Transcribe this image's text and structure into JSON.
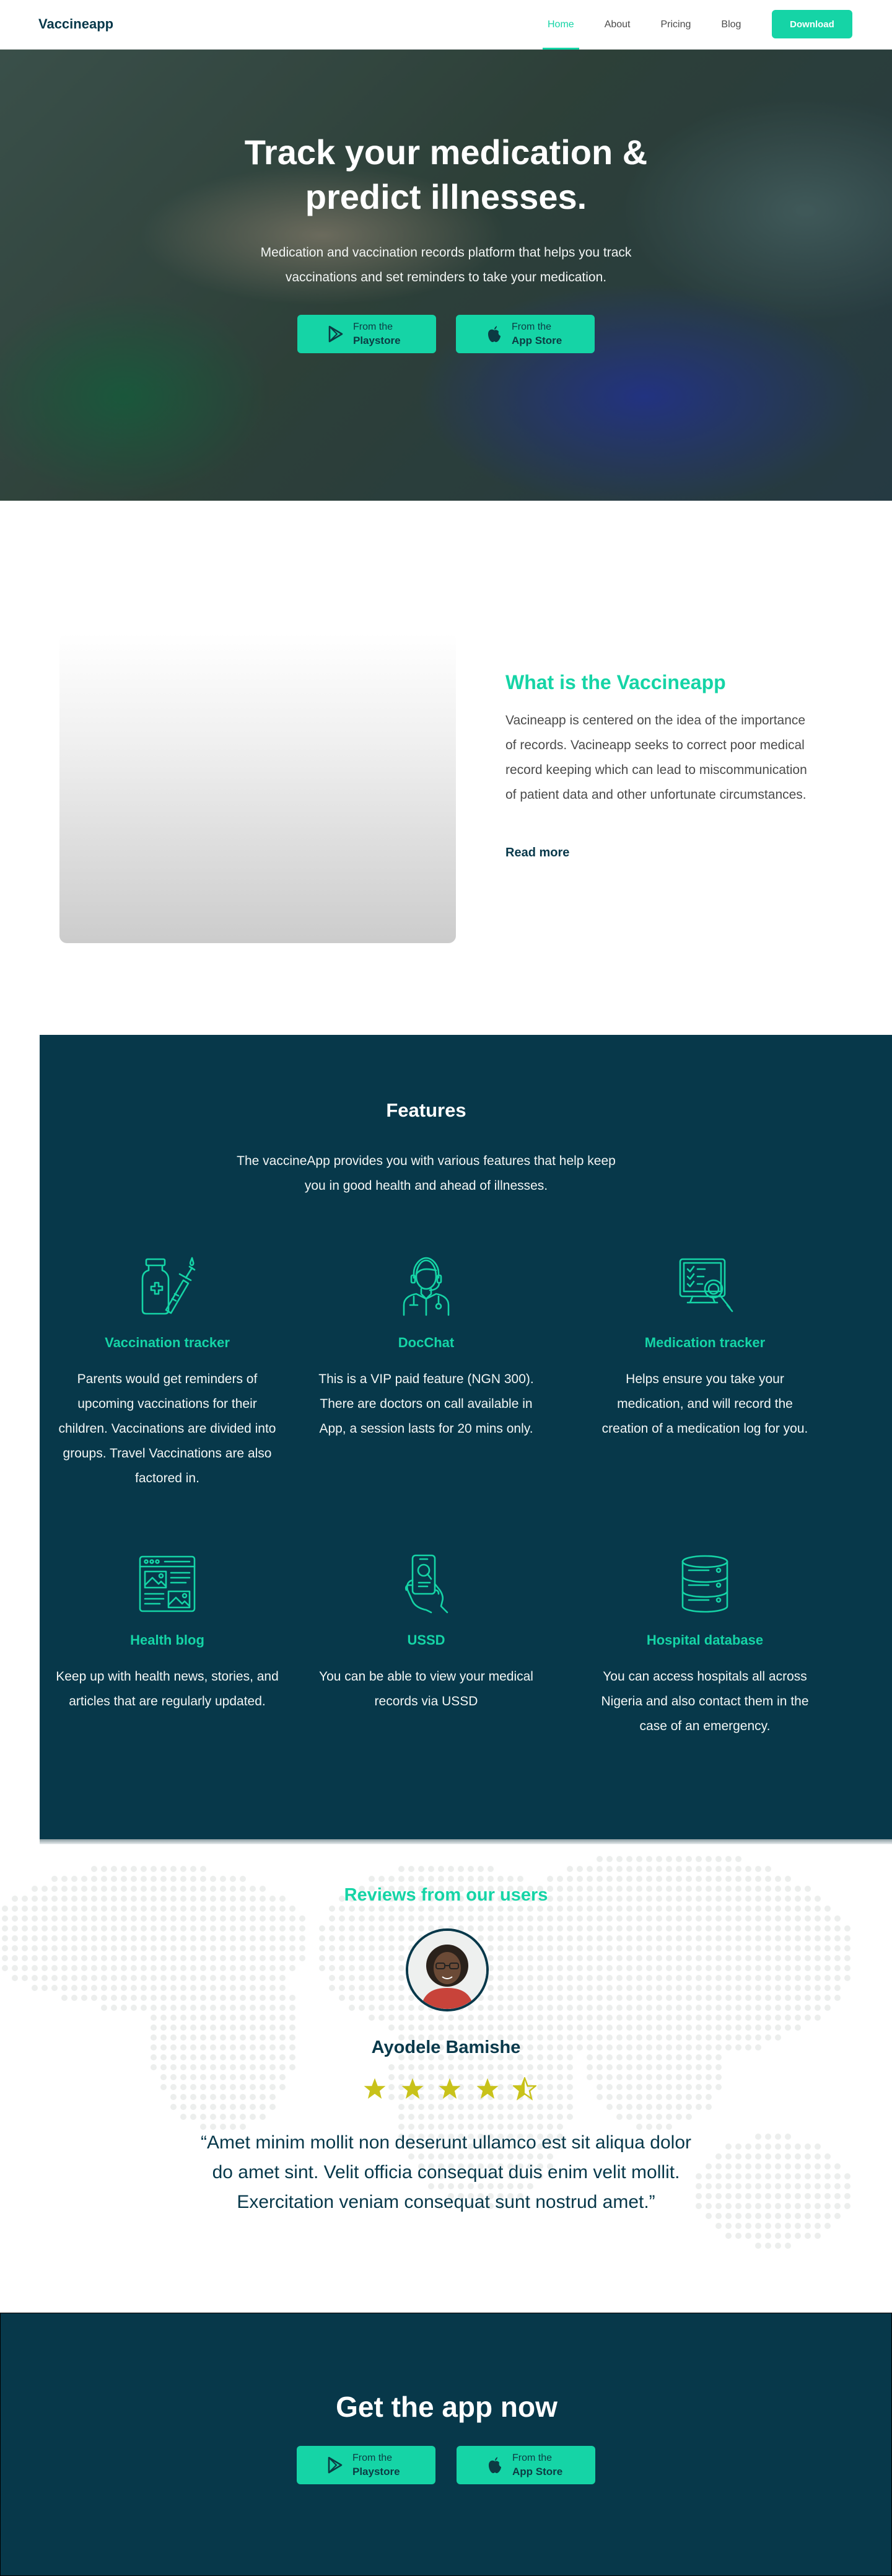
{
  "nav": {
    "brand": "Vaccineapp",
    "links": [
      "Home",
      "About",
      "Pricing",
      "Blog"
    ],
    "active": "Home",
    "download": "Download"
  },
  "hero": {
    "title": "Track your medication & predict illnesses.",
    "subtitle": "Medication and vaccination records platform that helps you track vaccinations and set reminders to take your medication.",
    "playstore": {
      "small": "From the",
      "big": "Playstore",
      "icon": "play-icon"
    },
    "appstore": {
      "small": "From the",
      "big": "App Store",
      "icon": "apple-icon"
    }
  },
  "about": {
    "title": "What is the Vaccineapp",
    "body": "Vacineapp is centered on the idea of the importance of records. Vacineapp seeks to correct  poor medical record keeping which can lead to miscommunication of patient data and other unfortunate circumstances.",
    "link": "Read more"
  },
  "features": {
    "title": "Features",
    "subtitle": "The vaccineApp provides you with various features that help keep you in good health and ahead of illnesses.",
    "items": [
      {
        "title": "Vaccination tracker",
        "text": "Parents would get reminders of upcoming vaccinations for their children. Vaccinations are divided into groups. Travel Vaccinations are also factored in.",
        "icon": "vaccine-icon"
      },
      {
        "title": "DocChat",
        "text": "This is a VIP paid feature (NGN 300). There are doctors on call available in App, a session lasts for 20 mins only.",
        "icon": "doctor-icon"
      },
      {
        "title": "Medication tracker",
        "text": "Helps ensure you take your medication, and  will record the creation of a medication log for you.",
        "icon": "monitor-search-icon"
      },
      {
        "title": "Health blog",
        "text": "Keep up with health news, stories, and articles that are regularly updated.",
        "icon": "blog-icon"
      },
      {
        "title": "USSD",
        "text": "You can  be able to view your medical records via USSD",
        "icon": "phone-hand-icon"
      },
      {
        "title": "Hospital database",
        "text": "You can  access hospitals all across Nigeria and also contact them in the case of an emergency.",
        "icon": "database-icon"
      }
    ]
  },
  "reviews": {
    "title": "Reviews from our users",
    "name": "Ayodele Bamishe",
    "rating": 4.5,
    "rating_max": 5,
    "quote": "“Amet minim mollit non deserunt ullamco est sit aliqua dolor do amet sint. Velit officia consequat duis enim velit mollit. Exercitation veniam consequat sunt nostrud amet.”"
  },
  "cta": {
    "title": "Get the app now",
    "playstore": {
      "small": "From the",
      "big": "Playstore"
    },
    "appstore": {
      "small": "From the",
      "big": "App Store"
    }
  },
  "colors": {
    "accent": "#15d4a6",
    "dark": "#07384a",
    "star": "#c8c21a"
  }
}
